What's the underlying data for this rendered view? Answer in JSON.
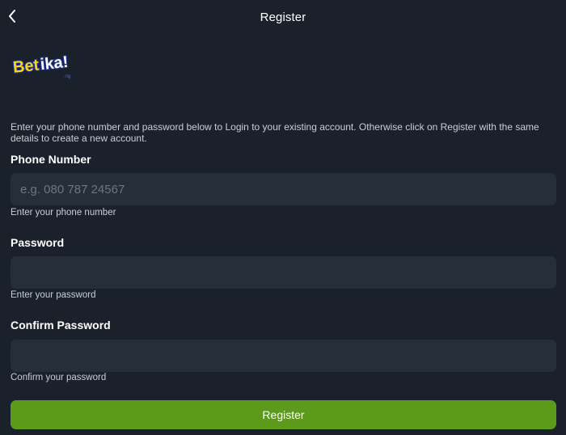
{
  "header": {
    "title": "Register",
    "back_icon": "chevron-left-icon"
  },
  "brand": {
    "logo_text": "Betika!",
    "logo_sub": ".ng",
    "colors": {
      "yellow": "#f7d51d",
      "blue": "#1e2f8f"
    }
  },
  "intro_text": "Enter your phone number and password below to Login to your existing account. Otherwise click on Register with the same details to create a new account.",
  "form": {
    "phone": {
      "label": "Phone Number",
      "placeholder": "e.g. 080 787 24567",
      "value": "",
      "help": "Enter your phone number"
    },
    "password": {
      "label": "Password",
      "placeholder": "",
      "value": "",
      "help": "Enter your password"
    },
    "confirm": {
      "label": "Confirm Password",
      "placeholder": "",
      "value": "",
      "help": "Confirm your password"
    },
    "submit_label": "Register"
  },
  "theme": {
    "background": "#1b212b",
    "input_bg": "#262e39",
    "accent_green": "#5b9a1a"
  }
}
